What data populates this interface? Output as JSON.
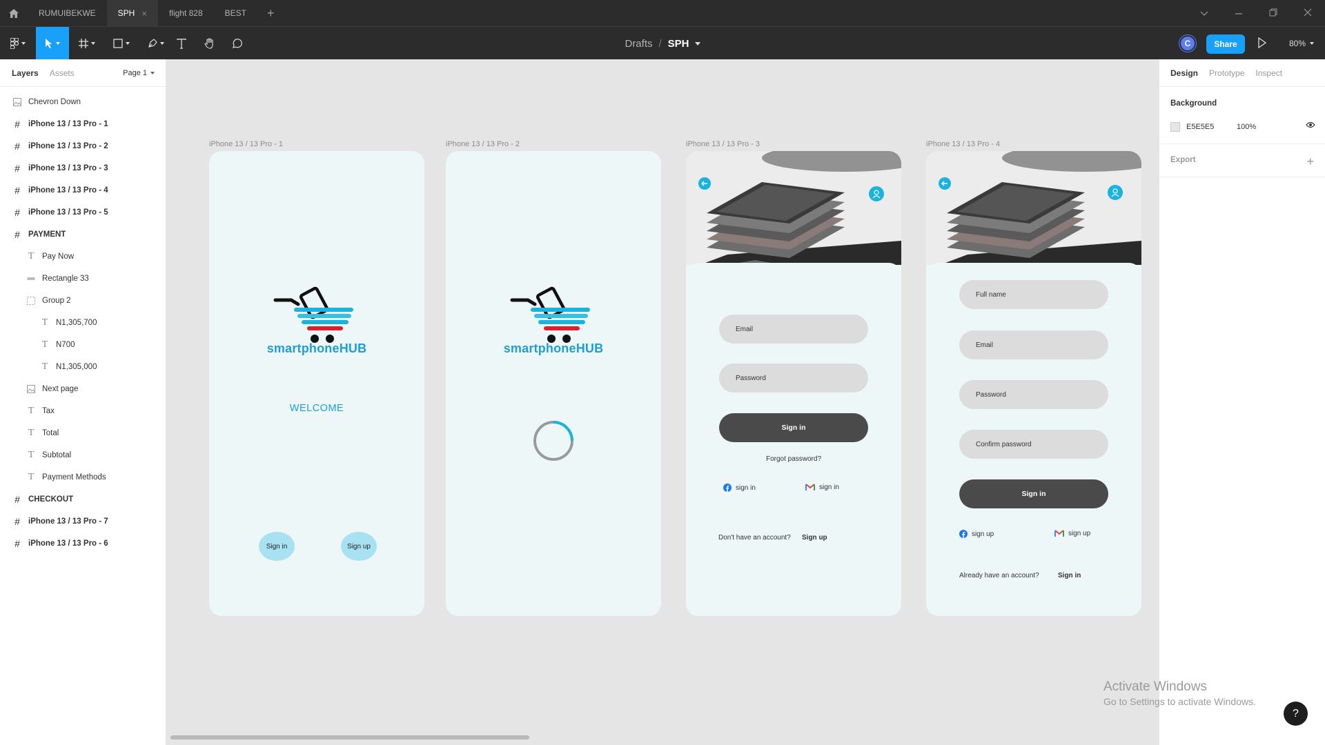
{
  "tabs": [
    {
      "label": "RUMUIBEKWE"
    },
    {
      "label": "SPH",
      "active": true
    },
    {
      "label": "flight 828"
    },
    {
      "label": "BEST"
    }
  ],
  "window_controls": {
    "chevron": "chevron-down-icon",
    "minimize": "minimize-icon",
    "restore": "restore-icon",
    "close": "close-icon"
  },
  "toolbar": {
    "breadcrumb_parent": "Drafts",
    "breadcrumb_sep": "/",
    "file_name": "SPH",
    "avatar_initial": "C",
    "share_label": "Share",
    "zoom": "80%",
    "accent": "#18a0fb"
  },
  "left_panel": {
    "tab_layers": "Layers",
    "tab_assets": "Assets",
    "page": "Page 1",
    "layers": [
      {
        "label": "Chevron Down",
        "icon": "image-icon",
        "indent": 0
      },
      {
        "label": "iPhone 13 / 13 Pro - 1",
        "icon": "frame-icon",
        "indent": 0
      },
      {
        "label": "iPhone 13 / 13 Pro - 2",
        "icon": "frame-icon",
        "indent": 0
      },
      {
        "label": "iPhone 13 / 13 Pro - 3",
        "icon": "frame-icon",
        "indent": 0
      },
      {
        "label": "iPhone 13 / 13 Pro - 4",
        "icon": "frame-icon",
        "indent": 0
      },
      {
        "label": "iPhone 13 / 13 Pro - 5",
        "icon": "frame-icon",
        "indent": 0
      },
      {
        "label": "PAYMENT",
        "icon": "frame-icon",
        "indent": 0
      },
      {
        "label": "Pay Now",
        "icon": "text-icon",
        "indent": 1
      },
      {
        "label": "Rectangle 33",
        "icon": "rectangle-icon",
        "indent": 1
      },
      {
        "label": "Group 2",
        "icon": "group-icon",
        "indent": 1
      },
      {
        "label": "N1,305,700",
        "icon": "text-icon",
        "indent": 2
      },
      {
        "label": "N700",
        "icon": "text-icon",
        "indent": 2
      },
      {
        "label": "N1,305,000",
        "icon": "text-icon",
        "indent": 2
      },
      {
        "label": "Next page",
        "icon": "image-icon",
        "indent": 1
      },
      {
        "label": "Tax",
        "icon": "text-icon",
        "indent": 1
      },
      {
        "label": "Total",
        "icon": "text-icon",
        "indent": 1
      },
      {
        "label": "Subtotal",
        "icon": "text-icon",
        "indent": 1
      },
      {
        "label": "Payment Methods",
        "icon": "text-icon",
        "indent": 1
      },
      {
        "label": "CHECKOUT",
        "icon": "frame-icon",
        "indent": 0
      },
      {
        "label": "iPhone 13 / 13 Pro - 7",
        "icon": "frame-icon",
        "indent": 0
      },
      {
        "label": "iPhone 13 / 13 Pro - 6",
        "icon": "frame-icon",
        "indent": 0
      }
    ]
  },
  "right_panel": {
    "tabs": [
      "Design",
      "Prototype",
      "Inspect"
    ],
    "background_title": "Background",
    "background_hex": "E5E5E5",
    "background_opacity": "100%",
    "export_title": "Export"
  },
  "frames": [
    {
      "label": "iPhone 13 / 13 Pro - 1",
      "logo_text": "smartphoneHUB",
      "welcome": "WELCOME",
      "signin": "Sign in",
      "signup": "Sign up"
    },
    {
      "label": "iPhone 13 / 13 Pro - 2",
      "logo_text": "smartphoneHUB",
      "loading_icon": "spinner-icon"
    },
    {
      "label": "iPhone 13 / 13 Pro - 3",
      "email": "Email",
      "password": "Password",
      "signin_button": "Sign in",
      "forgot": "Forgot password?",
      "facebook": "sign in",
      "gmail": "sign in",
      "no_account": "Don't have an account?",
      "signup_link": "Sign up"
    },
    {
      "label": "iPhone 13 / 13 Pro - 4",
      "fullname": "Full name",
      "email": "Email",
      "password": "Password",
      "confirm": "Confirm password",
      "signin_button": "Sign in",
      "facebook": "sign up",
      "gmail": "sign up",
      "have_account": "Already have an account?",
      "signin_link": "Sign in"
    }
  ],
  "brand_color": "#1e9ed6",
  "watermark": {
    "line1": "Activate Windows",
    "line2": "Go to Settings to activate Windows."
  },
  "help_label": "?"
}
